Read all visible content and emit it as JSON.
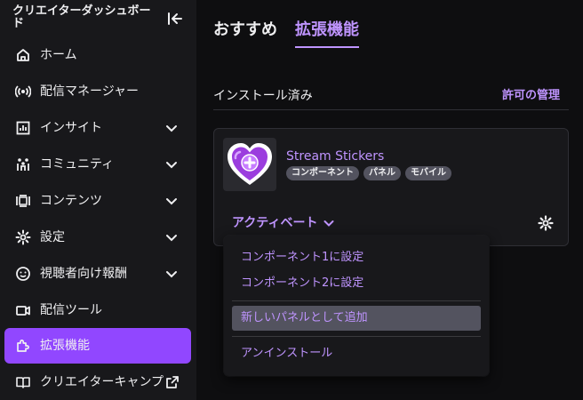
{
  "sidebar": {
    "title": "クリエイターダッシュボード",
    "items": [
      {
        "label": "ホーム",
        "icon": "home-icon",
        "chevron": false,
        "active": false
      },
      {
        "label": "配信マネージャー",
        "icon": "broadcast-icon",
        "chevron": false,
        "active": false
      },
      {
        "label": "インサイト",
        "icon": "insights-icon",
        "chevron": true,
        "active": false
      },
      {
        "label": "コミュニティ",
        "icon": "community-icon",
        "chevron": true,
        "active": false
      },
      {
        "label": "コンテンツ",
        "icon": "content-icon",
        "chevron": true,
        "active": false
      },
      {
        "label": "設定",
        "icon": "settings-gear-icon",
        "chevron": true,
        "active": false
      },
      {
        "label": "視聴者向け報酬",
        "icon": "viewer-rewards-icon",
        "chevron": true,
        "active": false
      },
      {
        "label": "配信ツール",
        "icon": "streaming-tools-icon",
        "chevron": false,
        "active": false
      },
      {
        "label": "拡張機能",
        "icon": "extensions-icon",
        "chevron": false,
        "active": true
      },
      {
        "label": "クリエイターキャンプ",
        "icon": "creator-camp-icon",
        "chevron": false,
        "active": false,
        "external": true
      }
    ]
  },
  "tabs": {
    "recommended": "おすすめ",
    "extensions": "拡張機能"
  },
  "installed": {
    "section_title": "インストール済み",
    "manage_link": "許可の管理"
  },
  "extension": {
    "name": "Stream Stickers",
    "tags": [
      "コンポーネント",
      "パネル",
      "モバイル"
    ],
    "activate_label": "アクティベート"
  },
  "dropdown": {
    "items": [
      "コンポーネント1に設定",
      "コンポーネント2に設定",
      "新しいパネルとして追加",
      "アンインストール"
    ],
    "hovered_index": 2
  },
  "colors": {
    "accent": "#bf94ff",
    "active_bg": "#9147ff",
    "background": "#0e0e10",
    "sidebar": "#18181b"
  }
}
